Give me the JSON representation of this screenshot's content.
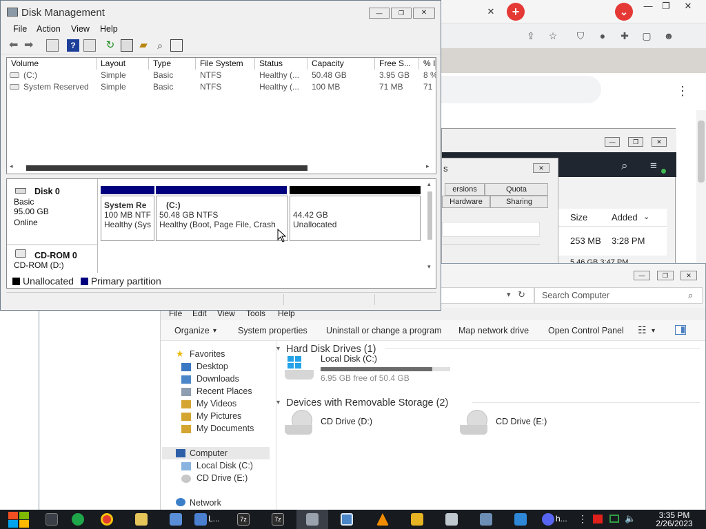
{
  "browser": {
    "close_tab": "✕",
    "new_tab": "+",
    "menu_down": "⌄",
    "min": "—",
    "max": "❐",
    "close": "✕",
    "more": "⋮"
  },
  "app_window": {
    "col_size": "Size",
    "col_added": "Added",
    "row_size": "253 MB",
    "row_added": "3:28 PM",
    "row2_partial": "5.46 GB   3:47 PM"
  },
  "properties_dialog": {
    "title_partial": "s",
    "tabs": [
      "ersions",
      "Quota",
      "Hardware",
      "Sharing"
    ]
  },
  "disk_management": {
    "title": "Disk Management",
    "menu": [
      "File",
      "Action",
      "View",
      "Help"
    ],
    "columns": [
      "Volume",
      "Layout",
      "Type",
      "File System",
      "Status",
      "Capacity",
      "Free S...",
      "% I"
    ],
    "volumes": [
      [
        "(C:)",
        "Simple",
        "Basic",
        "NTFS",
        "Healthy (...",
        "50.48 GB",
        "3.95 GB",
        "8 %"
      ],
      [
        "System Reserved",
        "Simple",
        "Basic",
        "NTFS",
        "Healthy (...",
        "100 MB",
        "71 MB",
        "71"
      ]
    ],
    "disk0": {
      "name": "Disk 0",
      "type": "Basic",
      "size": "95.00 GB",
      "state": "Online",
      "partitions": [
        {
          "name": "System Re",
          "line2": "100 MB NTF",
          "line3": "Healthy (Sys"
        },
        {
          "name": "(C:)",
          "line2": "50.48 GB NTFS",
          "line3": "Healthy (Boot, Page File, Crash"
        },
        {
          "name": "",
          "line2": "44.42 GB",
          "line3": "Unallocated"
        }
      ]
    },
    "cdrom": {
      "name": "CD-ROM 0",
      "sub": "CD-ROM (D:)"
    },
    "legend": [
      "Unallocated",
      "Primary partition"
    ]
  },
  "explorer": {
    "search_placeholder": "Search Computer",
    "menu": [
      "File",
      "Edit",
      "View",
      "Tools",
      "Help"
    ],
    "commands": [
      "Organize",
      "System properties",
      "Uninstall or change a program",
      "Map network drive",
      "Open Control Panel"
    ],
    "nav": {
      "favorites": "Favorites",
      "favorite_items": [
        "Desktop",
        "Downloads",
        "Recent Places",
        "My Videos",
        "My Pictures",
        "My Documents"
      ],
      "computer": "Computer",
      "computer_items": [
        "Local Disk (C:)",
        "CD Drive (E:)"
      ],
      "network": "Network"
    },
    "hard_disk_group": "Hard Disk Drives (1)",
    "local_disk": {
      "name": "Local Disk (C:)",
      "free": "6.95 GB free of 50.4 GB",
      "used_fraction": 0.862
    },
    "removable_group": "Devices with Removable Storage (2)",
    "cd_d": "CD Drive (D:)",
    "cd_e": "CD Drive (E:)"
  },
  "taskbar": {
    "item_l": "L...",
    "item_h": "h...",
    "time": "3:35 PM",
    "date": "2/26/2023"
  },
  "colors": {
    "primary_partition": "#00007f",
    "unallocated": "#000000",
    "taskbar": "#171a1f"
  }
}
